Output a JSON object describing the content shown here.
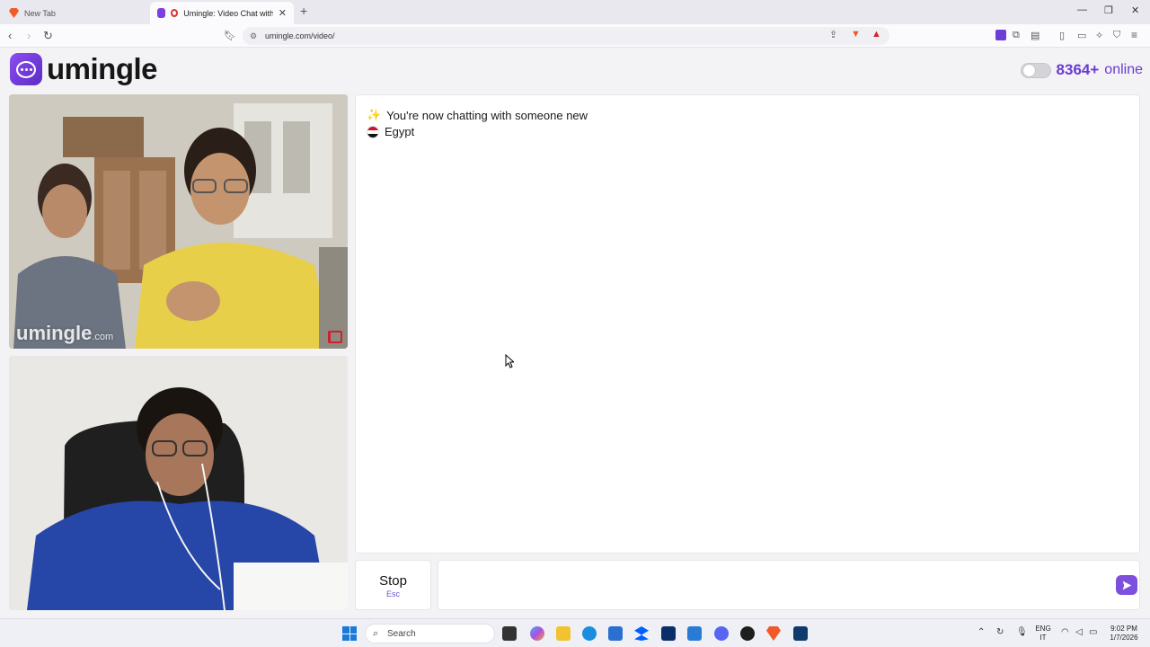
{
  "browser": {
    "tabs": [
      {
        "label": "New Tab",
        "active": false
      },
      {
        "label": "Umingle: Video Chat with Stra",
        "active": true
      }
    ],
    "url": "umingle.com/video/"
  },
  "site": {
    "logo_text": "umingle",
    "online_count": "8364+",
    "online_label": "online"
  },
  "remote_video": {
    "watermark_main": "umingle",
    "watermark_tld": ".com"
  },
  "chat": {
    "system_message": "You're now chatting with someone new",
    "partner_country": "Egypt",
    "stop_label": "Stop",
    "stop_hint": "Esc",
    "input_value": "",
    "input_placeholder": ""
  },
  "taskbar": {
    "search_label": "Search",
    "lang_top": "ENG",
    "lang_bottom": "IT",
    "time": "9:02 PM",
    "date": "1/7/2026"
  },
  "colors": {
    "accent": "#6a3bd0",
    "send_button": "#7c50dd",
    "report_flag": "#d21f2f"
  }
}
